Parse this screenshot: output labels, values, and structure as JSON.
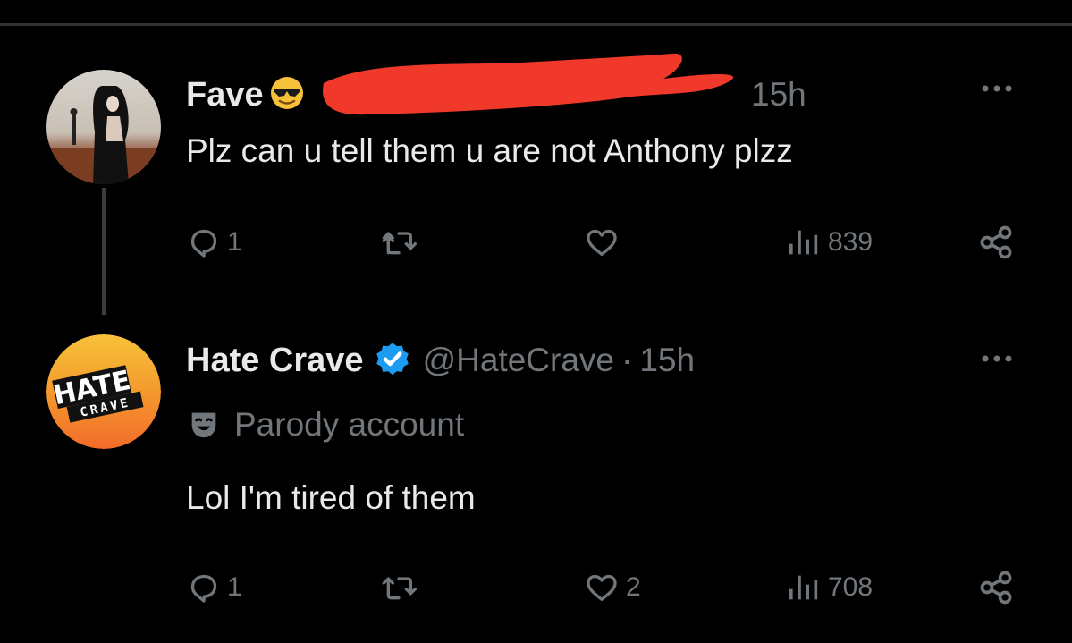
{
  "tweets": [
    {
      "display_name": "Fave",
      "time": "15h",
      "text": "Plz can u tell them u are not Anthony plzz",
      "reply_count": "1",
      "like_count": "",
      "view_count": "839"
    },
    {
      "display_name": "Hate Crave",
      "handle": "@HateCrave",
      "separator": "·",
      "time": "15h",
      "parody_label": "Parody account",
      "text": "Lol I'm tired of them",
      "reply_count": "1",
      "like_count": "2",
      "view_count": "708",
      "avatar_logo": {
        "line1": "HATE",
        "line2": "CRAVE"
      }
    }
  ],
  "colors": {
    "background": "#000000",
    "primary_text": "#e7e9ea",
    "secondary_text": "#71767b",
    "verified_blue": "#1d9bf0",
    "redaction_red": "#f0382b",
    "logo_orange": "#f26b2a",
    "logo_yellow": "#f7c23a"
  },
  "icons": [
    "reply-icon",
    "retweet-icon",
    "like-icon",
    "views-icon",
    "share-icon",
    "more-icon",
    "verified-icon",
    "parody-mask-icon",
    "sunglasses-emoji"
  ]
}
